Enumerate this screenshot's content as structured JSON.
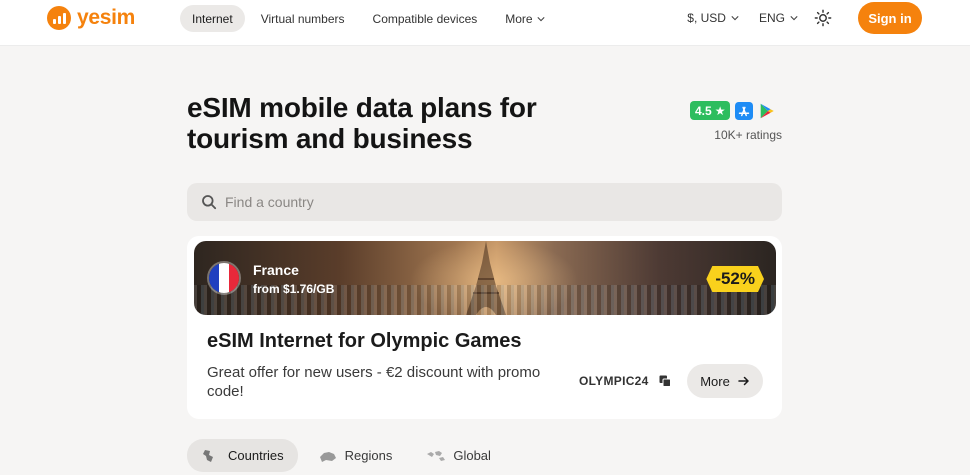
{
  "brand": {
    "name": "yesim",
    "color": "#f5820d"
  },
  "nav": {
    "items": [
      {
        "label": "Internet",
        "active": true
      },
      {
        "label": "Virtual numbers",
        "active": false
      },
      {
        "label": "Compatible devices",
        "active": false
      },
      {
        "label": "More",
        "active": false,
        "has_dropdown": true
      }
    ]
  },
  "header": {
    "currency": "$, USD",
    "language": "ENG",
    "theme_icon": "sun-icon",
    "signin_label": "Sign in"
  },
  "hero": {
    "title": "eSIM mobile data plans for tourism and business",
    "rating_value": "4.5",
    "rating_star": "★",
    "rating_text": "10K+ ratings",
    "stores": [
      "app-store-icon",
      "google-play-icon"
    ]
  },
  "search": {
    "placeholder": "Find a country",
    "value": ""
  },
  "promo": {
    "country": "France",
    "price": "from $1.76/GB",
    "discount": "-52%",
    "title": "eSIM Internet for Olympic Games",
    "description": "Great offer for new users - €2 discount with promo code!",
    "promo_code": "OLYMPIC24",
    "more_label": "More",
    "flag_colors": [
      "#1f3fbf",
      "#ffffff",
      "#e8283a"
    ]
  },
  "tabs": [
    {
      "label": "Countries",
      "icon": "country-map-icon",
      "active": true
    },
    {
      "label": "Regions",
      "icon": "region-map-icon",
      "active": false
    },
    {
      "label": "Global",
      "icon": "world-map-icon",
      "active": false
    }
  ]
}
